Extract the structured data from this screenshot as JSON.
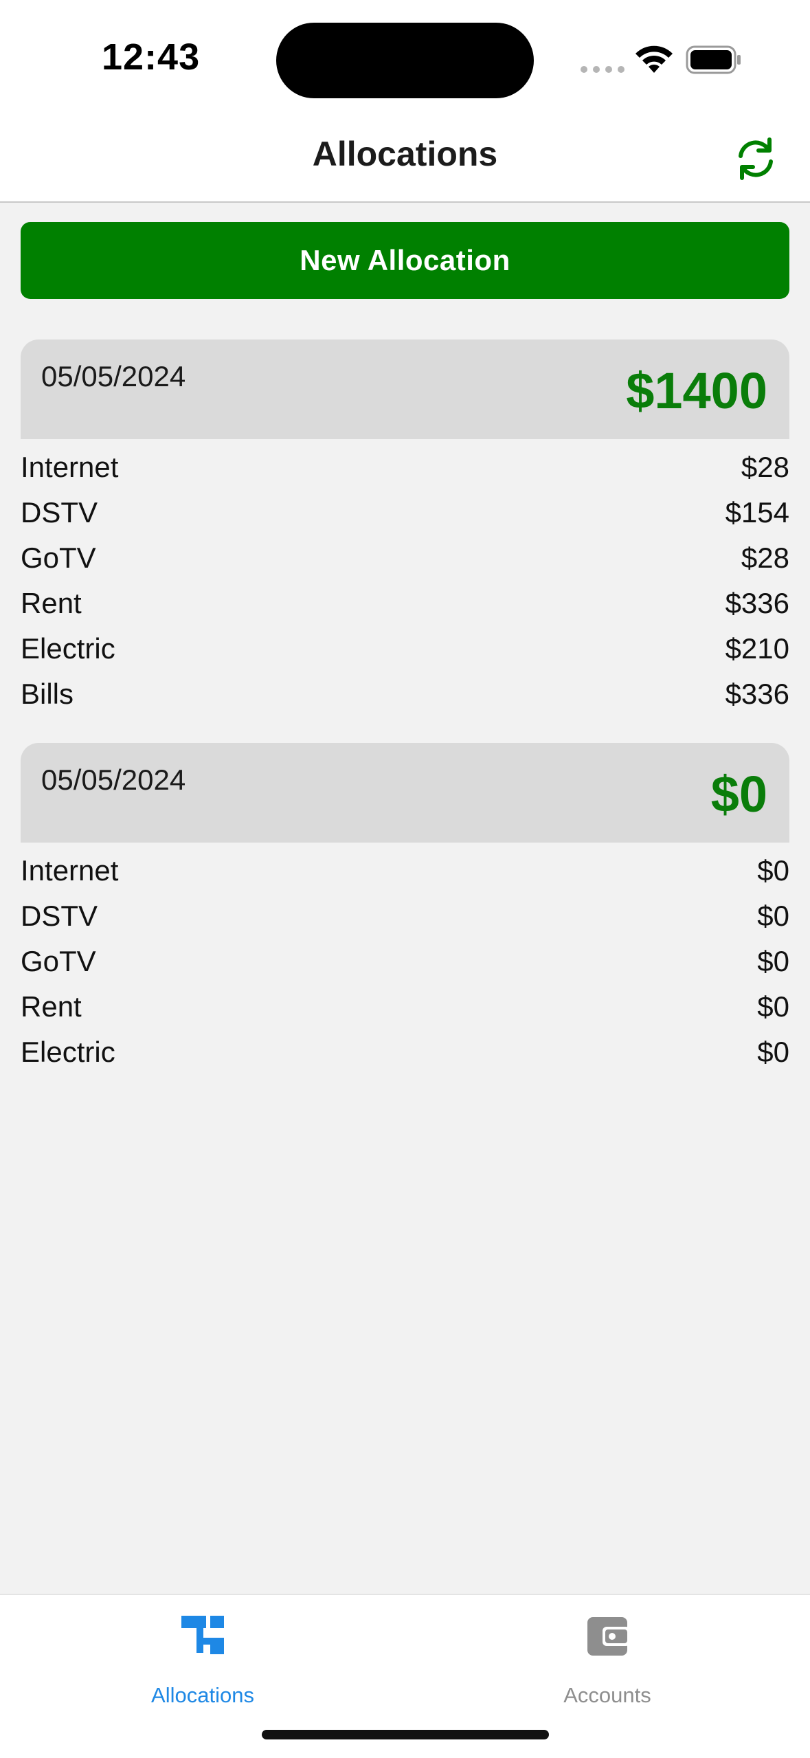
{
  "status_bar": {
    "time": "12:43"
  },
  "nav": {
    "title": "Allocations"
  },
  "actions": {
    "new_allocation_label": "New Allocation"
  },
  "allocations": [
    {
      "date": "05/05/2024",
      "total": "$1400",
      "items": [
        {
          "label": "Internet",
          "amount": "$28"
        },
        {
          "label": "DSTV",
          "amount": "$154"
        },
        {
          "label": "GoTV",
          "amount": "$28"
        },
        {
          "label": "Rent",
          "amount": "$336"
        },
        {
          "label": "Electric",
          "amount": "$210"
        },
        {
          "label": "Bills",
          "amount": "$336"
        }
      ]
    },
    {
      "date": "05/05/2024",
      "total": "$0",
      "items": [
        {
          "label": "Internet",
          "amount": "$0"
        },
        {
          "label": "DSTV",
          "amount": "$0"
        },
        {
          "label": "GoTV",
          "amount": "$0"
        },
        {
          "label": "Rent",
          "amount": "$0"
        },
        {
          "label": "Electric",
          "amount": "$0"
        }
      ]
    }
  ],
  "tabs": [
    {
      "label": "Allocations",
      "icon": "hierarchy-icon",
      "active": true
    },
    {
      "label": "Accounts",
      "icon": "wallet-icon",
      "active": false
    }
  ],
  "colors": {
    "primary_green": "#008000",
    "total_green": "#0a7d0a",
    "active_tab": "#1e88e5",
    "inactive_tab": "#8e8e8e"
  }
}
